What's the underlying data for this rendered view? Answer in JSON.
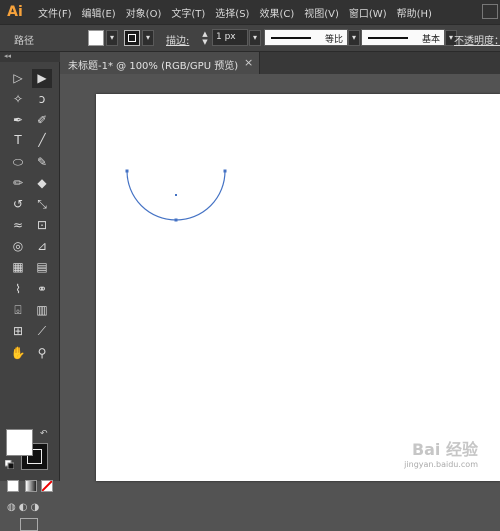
{
  "app": {
    "logo": "Ai"
  },
  "menu": [
    "文件(F)",
    "编辑(E)",
    "对象(O)",
    "文字(T)",
    "选择(S)",
    "效果(C)",
    "视图(V)",
    "窗口(W)",
    "帮助(H)"
  ],
  "control_bar": {
    "selection_label": "路径",
    "fill_color": "#ffffff",
    "stroke_color": "#1a1a1a",
    "stroke_label": "描边",
    "stroke_colon": ":",
    "stroke_width": "1 px",
    "profile_1": "等比",
    "profile_2": "基本",
    "opacity_label": "不透明度："
  },
  "document_tab": {
    "title": "未标题-1* @ 100% (RGB/GPU 预览)",
    "close": "×"
  },
  "toolbar": {
    "header": "◂◂",
    "tools": [
      {
        "name": "selection-tool-icon",
        "glyph": "▷"
      },
      {
        "name": "direct-selection-tool-icon",
        "glyph": "▶"
      },
      {
        "name": "magic-wand-tool-icon",
        "glyph": "✧"
      },
      {
        "name": "lasso-tool-icon",
        "glyph": "ↄ"
      },
      {
        "name": "pen-tool-icon",
        "glyph": "✒"
      },
      {
        "name": "curvature-tool-icon",
        "glyph": "✐"
      },
      {
        "name": "type-tool-icon",
        "glyph": "T"
      },
      {
        "name": "line-segment-tool-icon",
        "glyph": "╱"
      },
      {
        "name": "ellipse-tool-icon",
        "glyph": "⬭"
      },
      {
        "name": "paintbrush-tool-icon",
        "glyph": "✎"
      },
      {
        "name": "shaper-tool-icon",
        "glyph": "✏"
      },
      {
        "name": "eraser-tool-icon",
        "glyph": "◆"
      },
      {
        "name": "rotate-tool-icon",
        "glyph": "↺"
      },
      {
        "name": "scale-tool-icon",
        "glyph": "⤡"
      },
      {
        "name": "width-tool-icon",
        "glyph": "≈"
      },
      {
        "name": "free-transform-tool-icon",
        "glyph": "⊡"
      },
      {
        "name": "shape-builder-tool-icon",
        "glyph": "◎"
      },
      {
        "name": "perspective-grid-tool-icon",
        "glyph": "⊿"
      },
      {
        "name": "mesh-tool-icon",
        "glyph": "▦"
      },
      {
        "name": "gradient-tool-icon",
        "glyph": "▤"
      },
      {
        "name": "eyedropper-tool-icon",
        "glyph": "⌇"
      },
      {
        "name": "blend-tool-icon",
        "glyph": "⚭"
      },
      {
        "name": "symbol-sprayer-tool-icon",
        "glyph": "⌻"
      },
      {
        "name": "column-graph-tool-icon",
        "glyph": "▥"
      },
      {
        "name": "artboard-tool-icon",
        "glyph": "⊞"
      },
      {
        "name": "slice-tool-icon",
        "glyph": "⟋"
      },
      {
        "name": "hand-tool-icon",
        "glyph": "✋"
      },
      {
        "name": "zoom-tool-icon",
        "glyph": "⚲"
      }
    ],
    "fill_color": "#ffffff",
    "stroke_color": "#111111"
  },
  "canvas": {
    "arc_color": "#4472c4",
    "background": "#ffffff"
  },
  "watermark": {
    "main": "Bai 经验",
    "sub": "jingyan.baidu.com"
  }
}
